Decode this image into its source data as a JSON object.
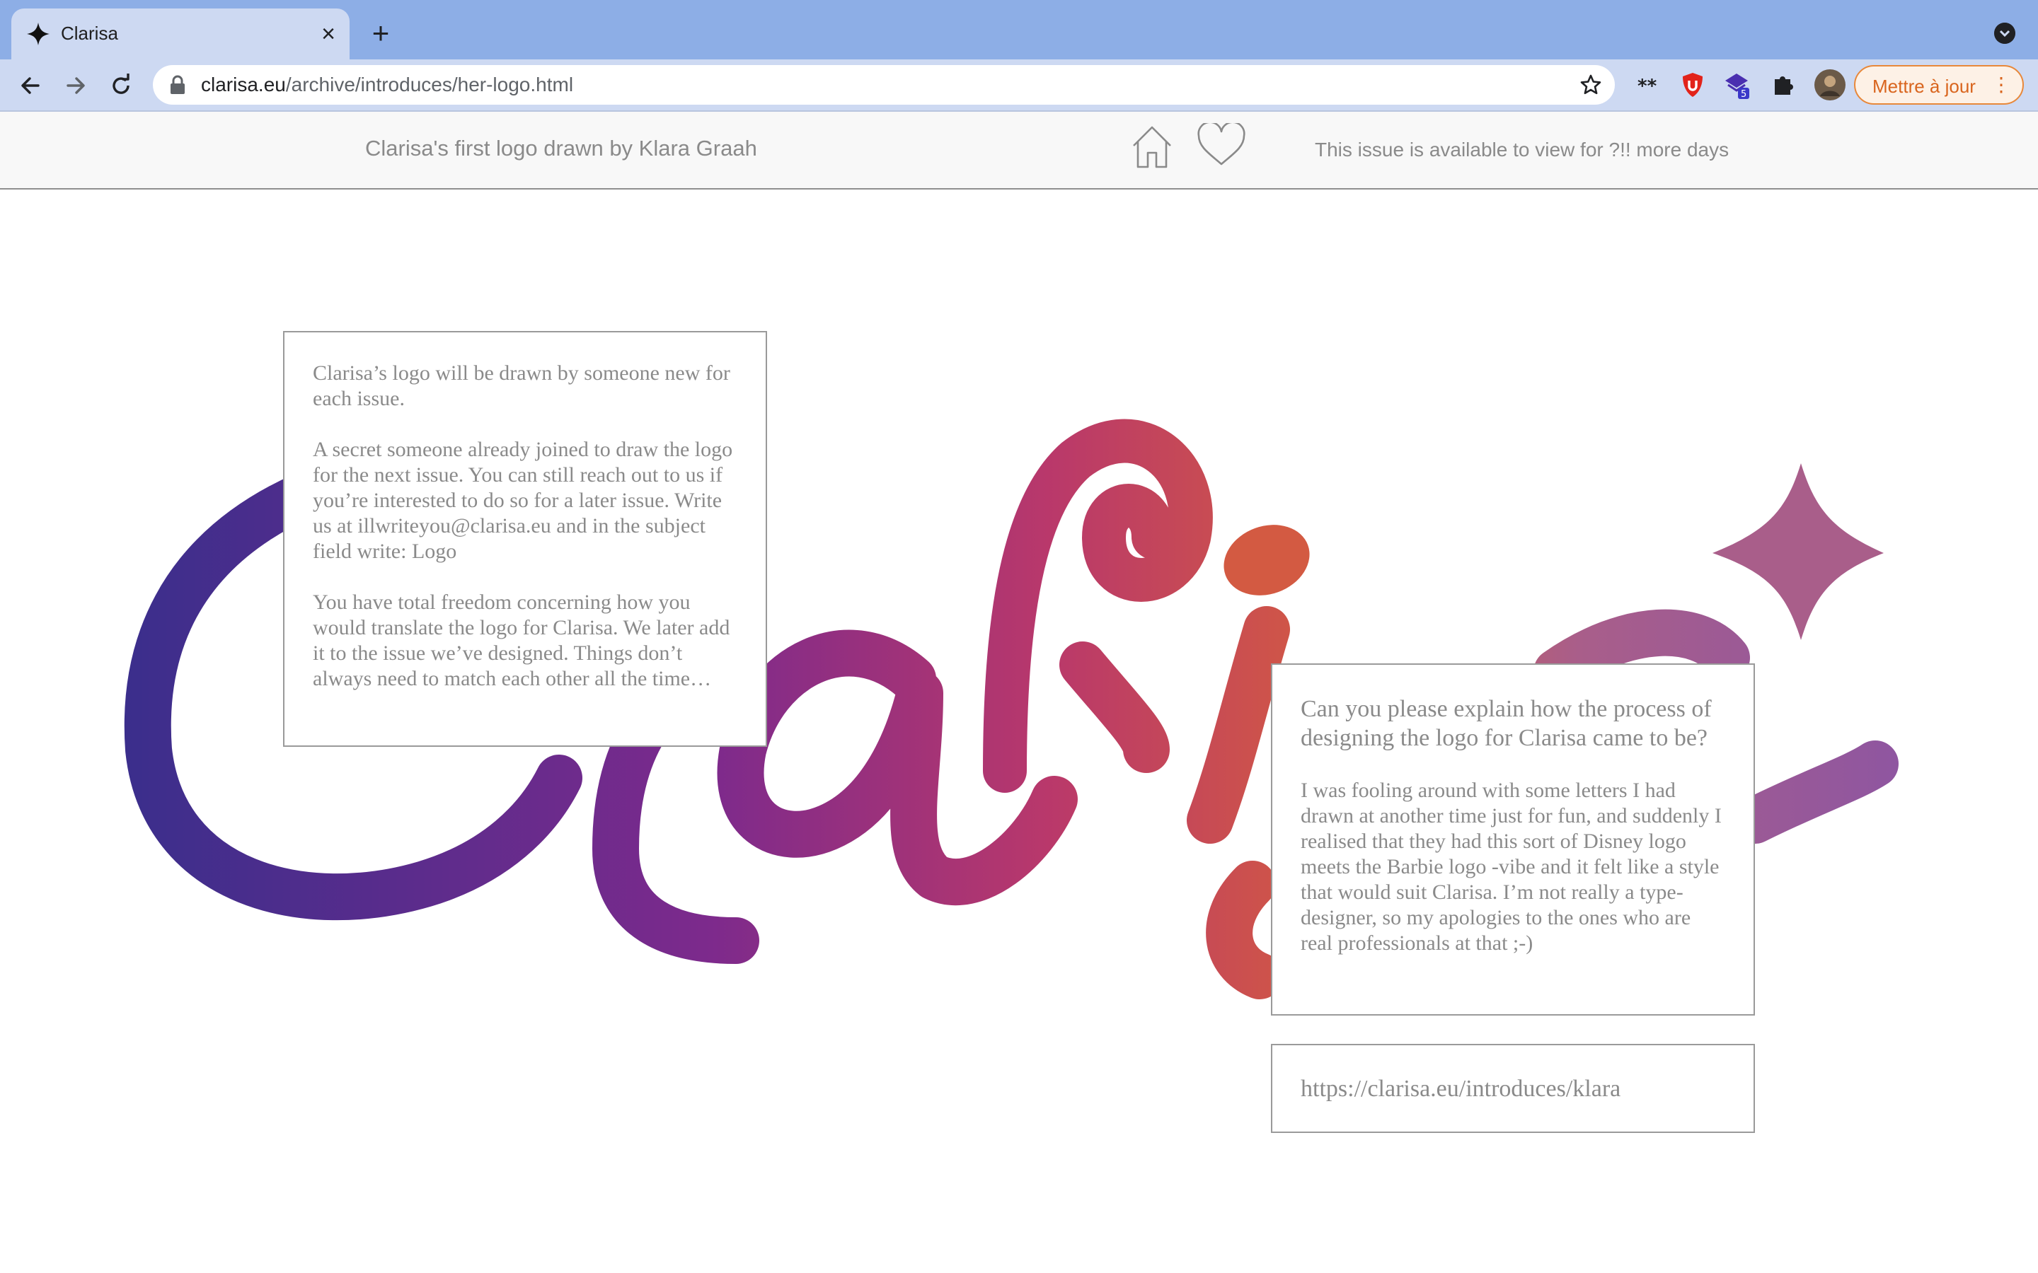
{
  "browser": {
    "tab_title": "Clarisa",
    "tab_close": "×",
    "new_tab": "+",
    "url_host": "clarisa.eu",
    "url_path": "/archive/introduces/her-logo.html",
    "update_button": "Mettre à jour",
    "update_menu": "⋮",
    "extension_badge": "5"
  },
  "header": {
    "caption": "Clarisa's first logo drawn by Klara Graah",
    "availability": "This issue is available to view for ?!! more days"
  },
  "info_box": {
    "paragraphs": [
      "Clarisa’s logo will be drawn by someone new for each issue.",
      "A secret someone already joined to draw the logo for the next issue. You can still reach out to us if you’re interested to do so for a later issue. Write us at illwriteyou@clarisa.eu and in the subject field write: Logo",
      "You have total freedom concerning how you would translate the logo for Clarisa. We later add it to the issue we’ve designed. Things don’t always need to match each other all the time…"
    ]
  },
  "qa_box": {
    "question": "Can you please explain how the process of designing the logo for Clarisa came to be?",
    "answer": "I was fooling around with some letters I had drawn at another time just for fun, and suddenly I realised that they had this sort of Disney logo meets the Barbie logo -vibe and it felt like a style that would suit Clarisa. I’m not really a type-designer, so my apologies to the ones who are real professionals at that ;-)"
  },
  "link_box": {
    "url": "https://clarisa.eu/introduces/klara"
  },
  "colors": {
    "logo_gradient": [
      "#3b2e8c",
      "#7d2a8c",
      "#b9386b",
      "#d35a42",
      "#a95e8a",
      "#8f56a0"
    ],
    "text_gray": "#8a8a8a",
    "tabstrip": "#8daee6",
    "toolbar": "#cdd9f2",
    "update_accent": "#e8883a"
  },
  "icons": {
    "favicon": "four-point-star-icon",
    "home": "home-icon",
    "favorite": "heart-icon"
  }
}
